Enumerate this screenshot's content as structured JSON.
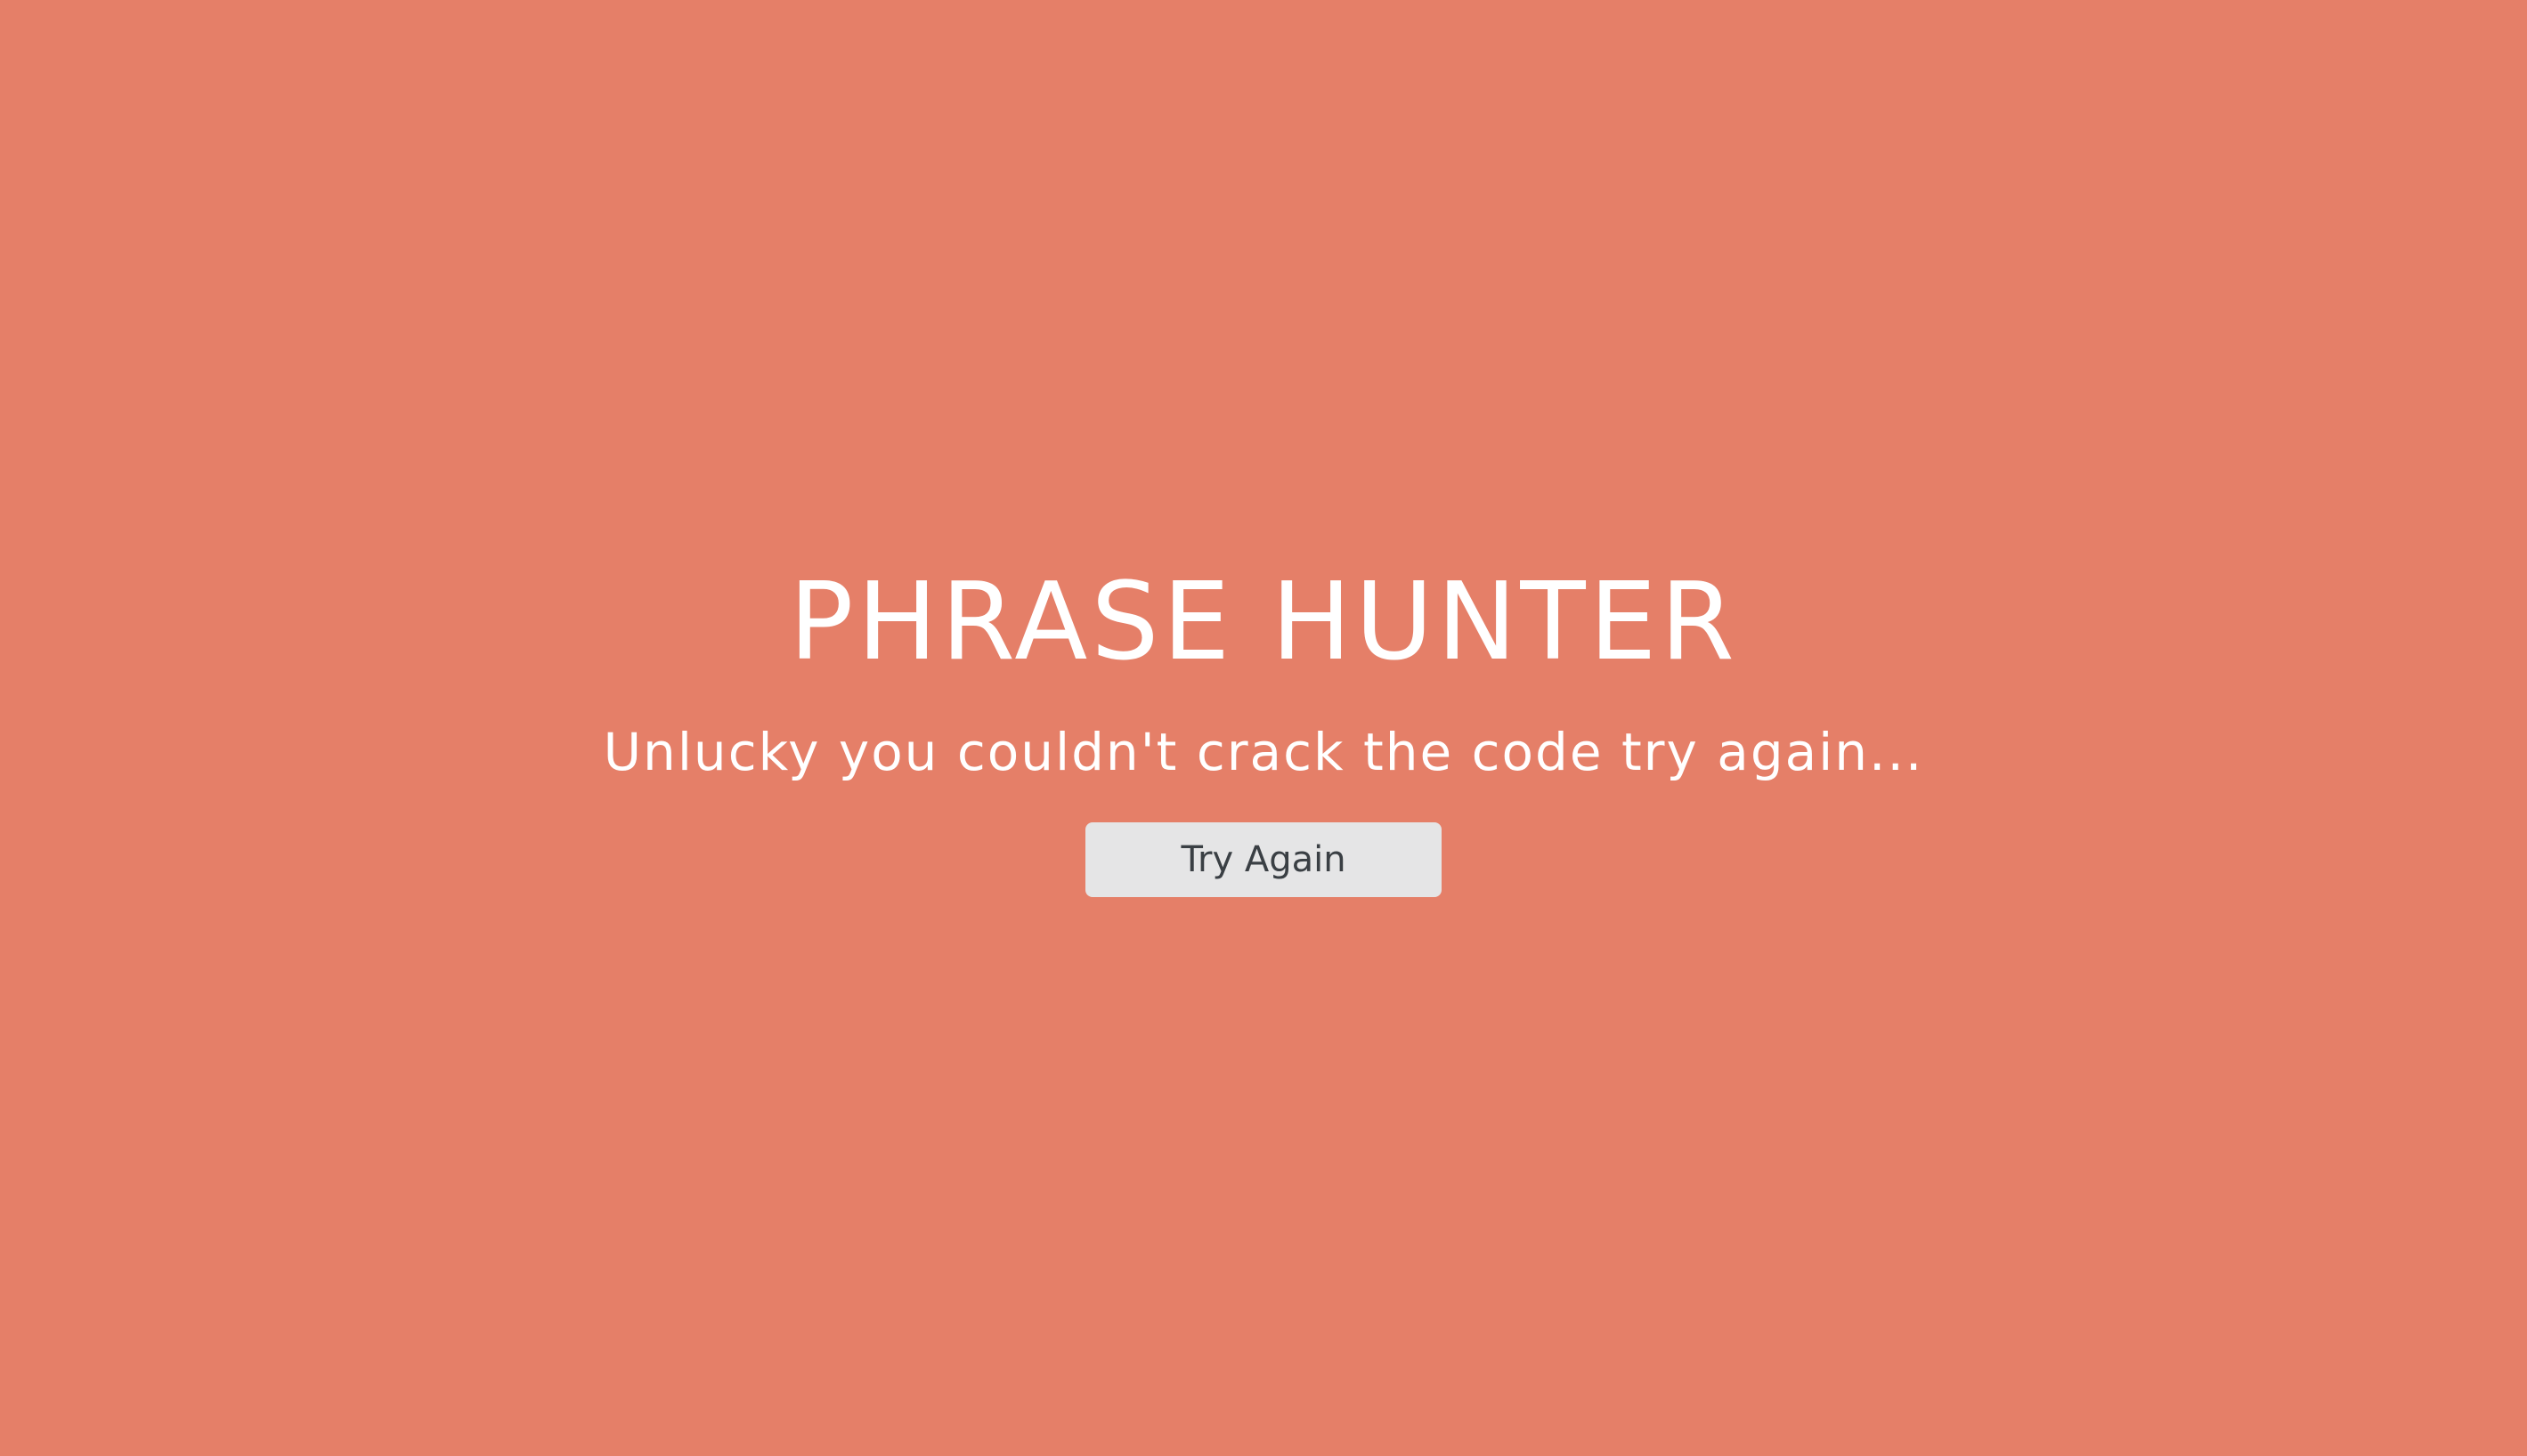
{
  "colors": {
    "background": "#e57f68",
    "title_text": "#ffffff",
    "button_bg": "#e5e5e6",
    "button_text": "#3a3f44"
  },
  "overlay": {
    "title": "PHRASE HUNTER",
    "message": "Unlucky you couldn't crack the code try again...",
    "button_label": "Try Again"
  }
}
